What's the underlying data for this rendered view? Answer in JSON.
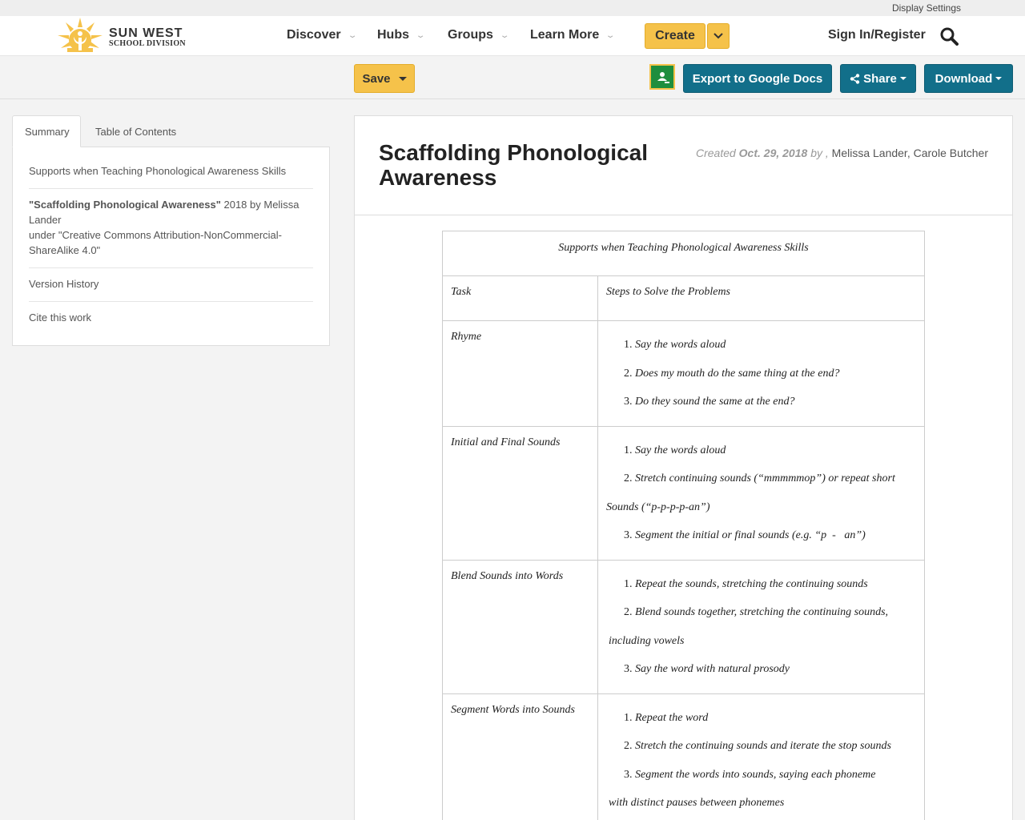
{
  "util_bar": {
    "display_settings": "Display Settings"
  },
  "brand": {
    "name": "SUN WEST",
    "subtitle": "SCHOOL DIVISION",
    "color": "#f5c24a"
  },
  "nav": {
    "items": [
      {
        "label": "Discover"
      },
      {
        "label": "Hubs"
      },
      {
        "label": "Groups"
      },
      {
        "label": "Learn More"
      }
    ],
    "create_label": "Create",
    "sign_in_label": "Sign In/Register"
  },
  "toolbar": {
    "save_label": "Save",
    "export_label": "Export to Google Docs",
    "share_label": "Share",
    "download_label": "Download",
    "accent_color": "#126f8a"
  },
  "sidebar": {
    "tabs": [
      {
        "label": "Summary",
        "active": true
      },
      {
        "label": "Table of Contents",
        "active": false
      }
    ],
    "items": {
      "summary_title": "Supports when Teaching Phonological Awareness Skills",
      "license_title": "\"Scaffolding Phonological Awareness\"",
      "license_rest": " 2018 by Melissa Lander",
      "license_line2": "under \"Creative Commons Attribution-NonCommercial-ShareAlike 4.0\"",
      "version_history": "Version History",
      "cite": "Cite this work"
    }
  },
  "document": {
    "title": "Scaffolding Phonological Awareness",
    "meta": {
      "created_label": "Created",
      "date": "Oct. 29, 2018",
      "by_label": "by ,",
      "author1": "Melissa Lander",
      "author2": "Carole Butcher"
    },
    "table": {
      "caption": "Supports when Teaching Phonological Awareness Skills",
      "header": {
        "task": "Task",
        "steps": "Steps to Solve the Problems"
      },
      "rows": [
        {
          "task": "Rhyme",
          "steps": [
            {
              "n": "1.",
              "text": "Say the words aloud"
            },
            {
              "n": "2.",
              "text": "Does my mouth do the same thing at the end?"
            },
            {
              "n": "3.",
              "text": "Do they sound the same at the end?"
            }
          ]
        },
        {
          "task": "Initial and Final Sounds",
          "steps": [
            {
              "n": "1.",
              "text": "Say the words aloud"
            },
            {
              "n": "2.",
              "text": "Stretch continuing sounds (“mmmmmop”) or repeat short",
              "cont": "Sounds (“p-p-p-p-an”)"
            },
            {
              "n": "3.",
              "text": "Segment the initial or final sounds (e.g. “p  -   an”)"
            }
          ]
        },
        {
          "task": "Blend Sounds into Words",
          "steps": [
            {
              "n": "1.",
              "text": "Repeat the sounds, stretching the continuing sounds"
            },
            {
              "n": "2.",
              "text": "Blend sounds together, stretching the continuing sounds,",
              "cont": "including vowels"
            },
            {
              "n": "3.",
              "text": "Say the word with natural prosody"
            }
          ]
        },
        {
          "task": "Segment Words into Sounds",
          "steps": [
            {
              "n": "1.",
              "text": "Repeat the word"
            },
            {
              "n": "2.",
              "text": "Stretch the continuing sounds and iterate the stop sounds"
            },
            {
              "n": "3.",
              "text": "Segment the words into sounds, saying each phoneme",
              "cont": "with distinct pauses between phonemes"
            }
          ]
        }
      ]
    }
  }
}
